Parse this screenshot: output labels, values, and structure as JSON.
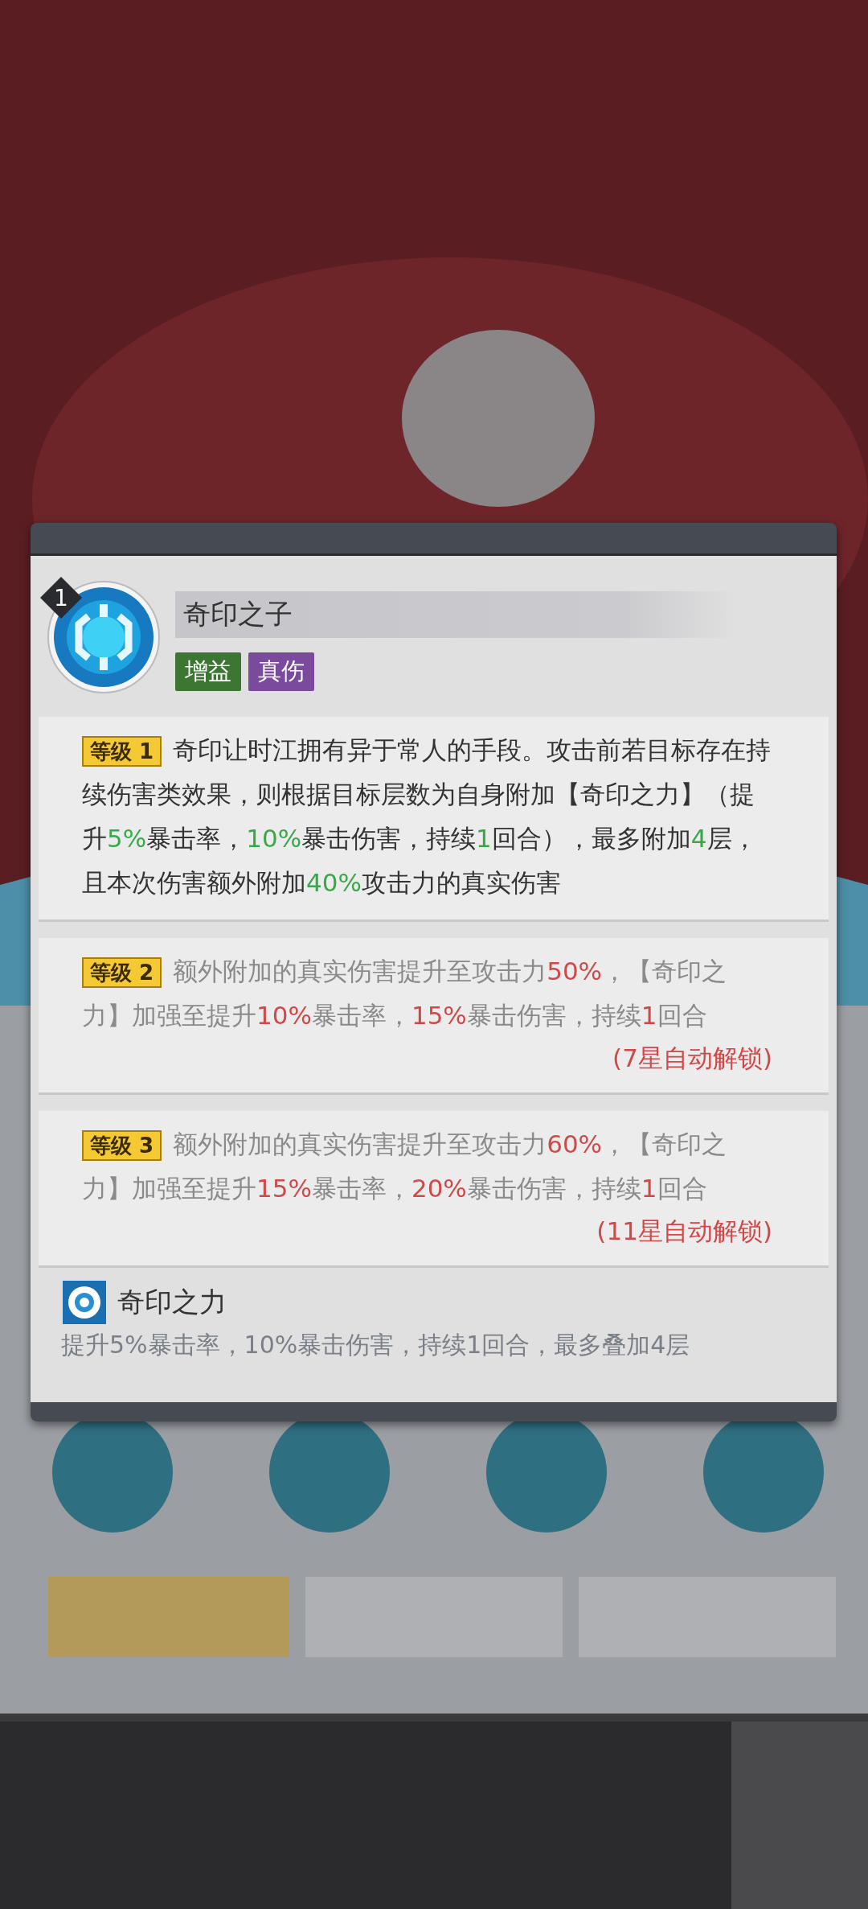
{
  "skill": {
    "rank": "1",
    "title": "奇印之子",
    "tags": [
      {
        "label": "增益",
        "color": "#3d7533"
      },
      {
        "label": "真伤",
        "color": "#7a4a9c"
      }
    ]
  },
  "levels": [
    {
      "badge": "等级 1",
      "unlocked": true,
      "segments": [
        {
          "text": "奇印让时江拥有异于常人的手段。攻击前若目标存在持续伤害类效果，则根据目标层数为自身附加【奇印之力】（提升",
          "highlight": false
        },
        {
          "text": "5%",
          "highlight": true
        },
        {
          "text": "暴击率，",
          "highlight": false
        },
        {
          "text": "10%",
          "highlight": true
        },
        {
          "text": "暴击伤害，持续",
          "highlight": false
        },
        {
          "text": "1",
          "highlight": true
        },
        {
          "text": "回合），最多附加",
          "highlight": false
        },
        {
          "text": "4",
          "highlight": true
        },
        {
          "text": "层，且本次伤害额外附加",
          "highlight": false
        },
        {
          "text": "40%",
          "highlight": true
        },
        {
          "text": "攻击力的真实伤害",
          "highlight": false
        }
      ]
    },
    {
      "badge": "等级 2",
      "unlocked": false,
      "unlock_note": "(7星自动解锁)",
      "segments": [
        {
          "text": "额外附加的真实伤害提升至攻击力",
          "highlight": false
        },
        {
          "text": "50%",
          "highlight": true
        },
        {
          "text": "，【奇印之力】加强至提升",
          "highlight": false
        },
        {
          "text": "10%",
          "highlight": true
        },
        {
          "text": "暴击率，",
          "highlight": false
        },
        {
          "text": "15%",
          "highlight": true
        },
        {
          "text": "暴击伤害，持续",
          "highlight": false
        },
        {
          "text": "1",
          "highlight": true
        },
        {
          "text": "回合",
          "highlight": false
        }
      ]
    },
    {
      "badge": "等级 3",
      "unlocked": false,
      "unlock_note": "(11星自动解锁)",
      "segments": [
        {
          "text": "额外附加的真实伤害提升至攻击力",
          "highlight": false
        },
        {
          "text": "60%",
          "highlight": true
        },
        {
          "text": "，【奇印之力】加强至提升",
          "highlight": false
        },
        {
          "text": "15%",
          "highlight": true
        },
        {
          "text": "暴击率，",
          "highlight": false
        },
        {
          "text": "20%",
          "highlight": true
        },
        {
          "text": "暴击伤害，持续",
          "highlight": false
        },
        {
          "text": "1",
          "highlight": true
        },
        {
          "text": "回合",
          "highlight": false
        }
      ]
    }
  ],
  "buff": {
    "name": "奇印之力",
    "description": "提升5%暴击率，10%暴击伤害，持续1回合，最多叠加4层"
  }
}
